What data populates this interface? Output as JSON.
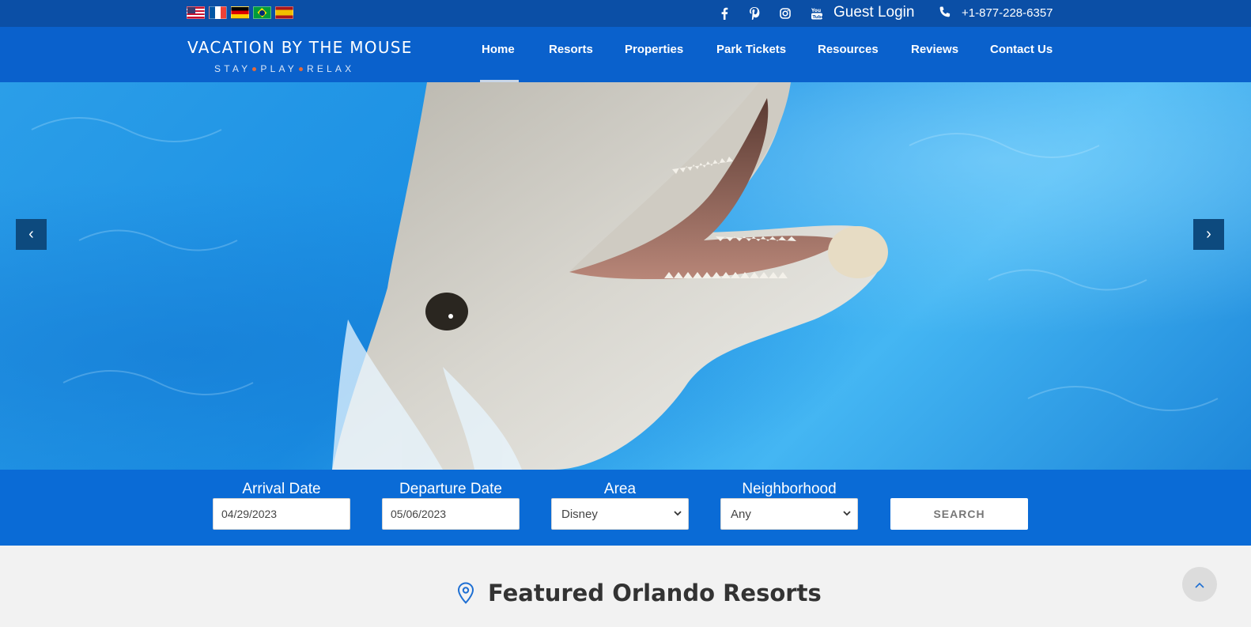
{
  "topbar": {
    "languages": [
      {
        "name": "us-flag-icon"
      },
      {
        "name": "fr-flag-icon"
      },
      {
        "name": "de-flag-icon"
      },
      {
        "name": "br-flag-icon"
      },
      {
        "name": "es-flag-icon"
      }
    ],
    "social_icons": [
      "facebook-icon",
      "pinterest-icon",
      "instagram-icon",
      "youtube-icon"
    ],
    "guest_login": "Guest Login",
    "phone": "+1-877-228-6357"
  },
  "logo": {
    "title": "VACATION BY THE MOUSE",
    "sub": [
      "STAY",
      "PLAY",
      "RELAX"
    ]
  },
  "nav": {
    "items": [
      "Home",
      "Resorts",
      "Properties",
      "Park Tickets",
      "Resources",
      "Reviews",
      "Contact Us"
    ],
    "active": "Home"
  },
  "hero": {
    "prev_icon": "chevron-left-icon",
    "next_icon": "chevron-right-icon",
    "prev_glyph": "‹",
    "next_glyph": "›"
  },
  "search": {
    "arrival_label": "Arrival Date",
    "arrival_value": "04/29/2023",
    "departure_label": "Departure Date",
    "departure_value": "05/06/2023",
    "area_label": "Area",
    "area_value": "Disney",
    "neighborhood_label": "Neighborhood",
    "neighborhood_value": "Any",
    "button": "SEARCH"
  },
  "featured": {
    "title": "Featured Orlando Resorts",
    "back_to_top_glyph": "⌃"
  },
  "colors": {
    "topbar": "#0b4fa6",
    "nav": "#0a61cc",
    "search_band": "#0a6bd6"
  }
}
